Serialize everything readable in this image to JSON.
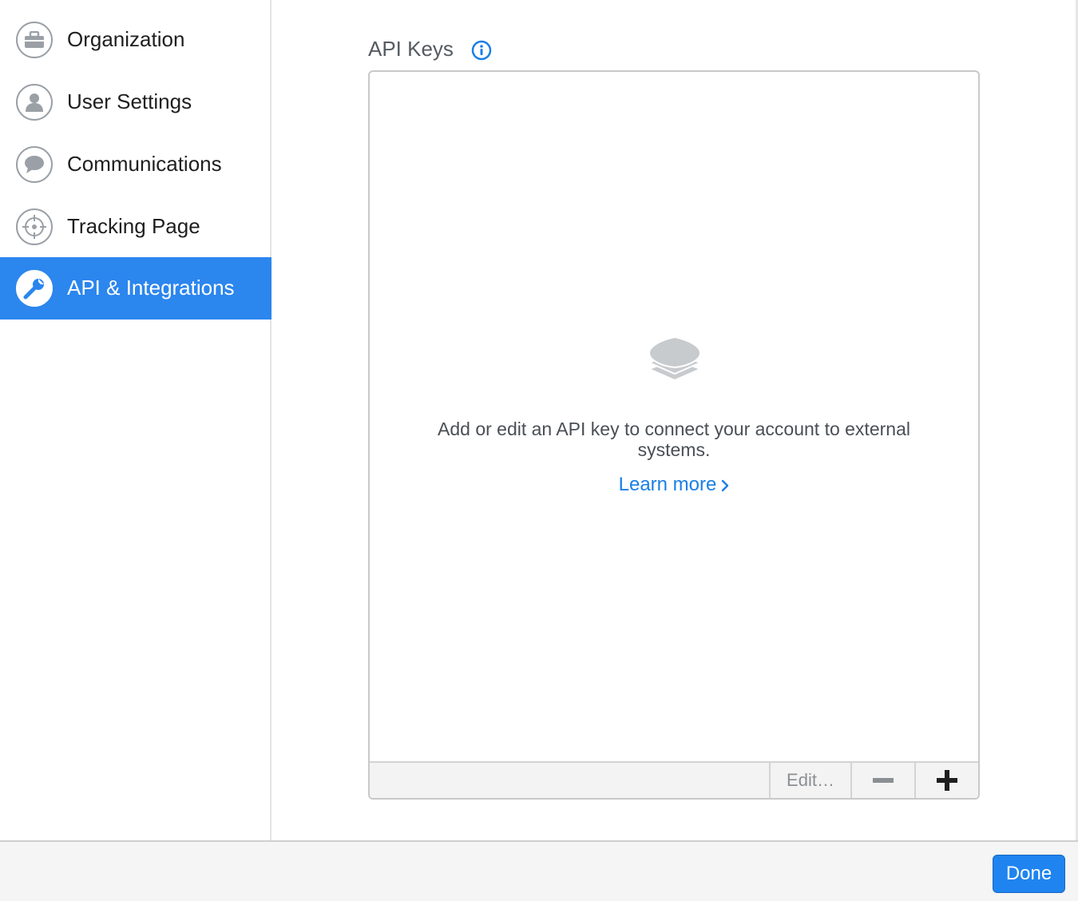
{
  "sidebar": {
    "items": [
      {
        "label": "Organization",
        "icon": "briefcase-icon"
      },
      {
        "label": "User Settings",
        "icon": "user-icon"
      },
      {
        "label": "Communications",
        "icon": "chat-bubble-icon"
      },
      {
        "label": "Tracking Page",
        "icon": "crosshair-icon"
      },
      {
        "label": "API & Integrations",
        "icon": "wrench-icon",
        "active": true
      }
    ]
  },
  "main": {
    "title": "API Keys",
    "empty_state": {
      "message": "Add or edit an API key to connect your account to external systems.",
      "link": "Learn more"
    },
    "toolbar": {
      "edit_label": "Edit…"
    }
  },
  "footer": {
    "done_label": "Done"
  },
  "colors": {
    "accent": "#2b86ee",
    "link": "#1a7fe6",
    "icon_gray": "#9aa0a6"
  }
}
